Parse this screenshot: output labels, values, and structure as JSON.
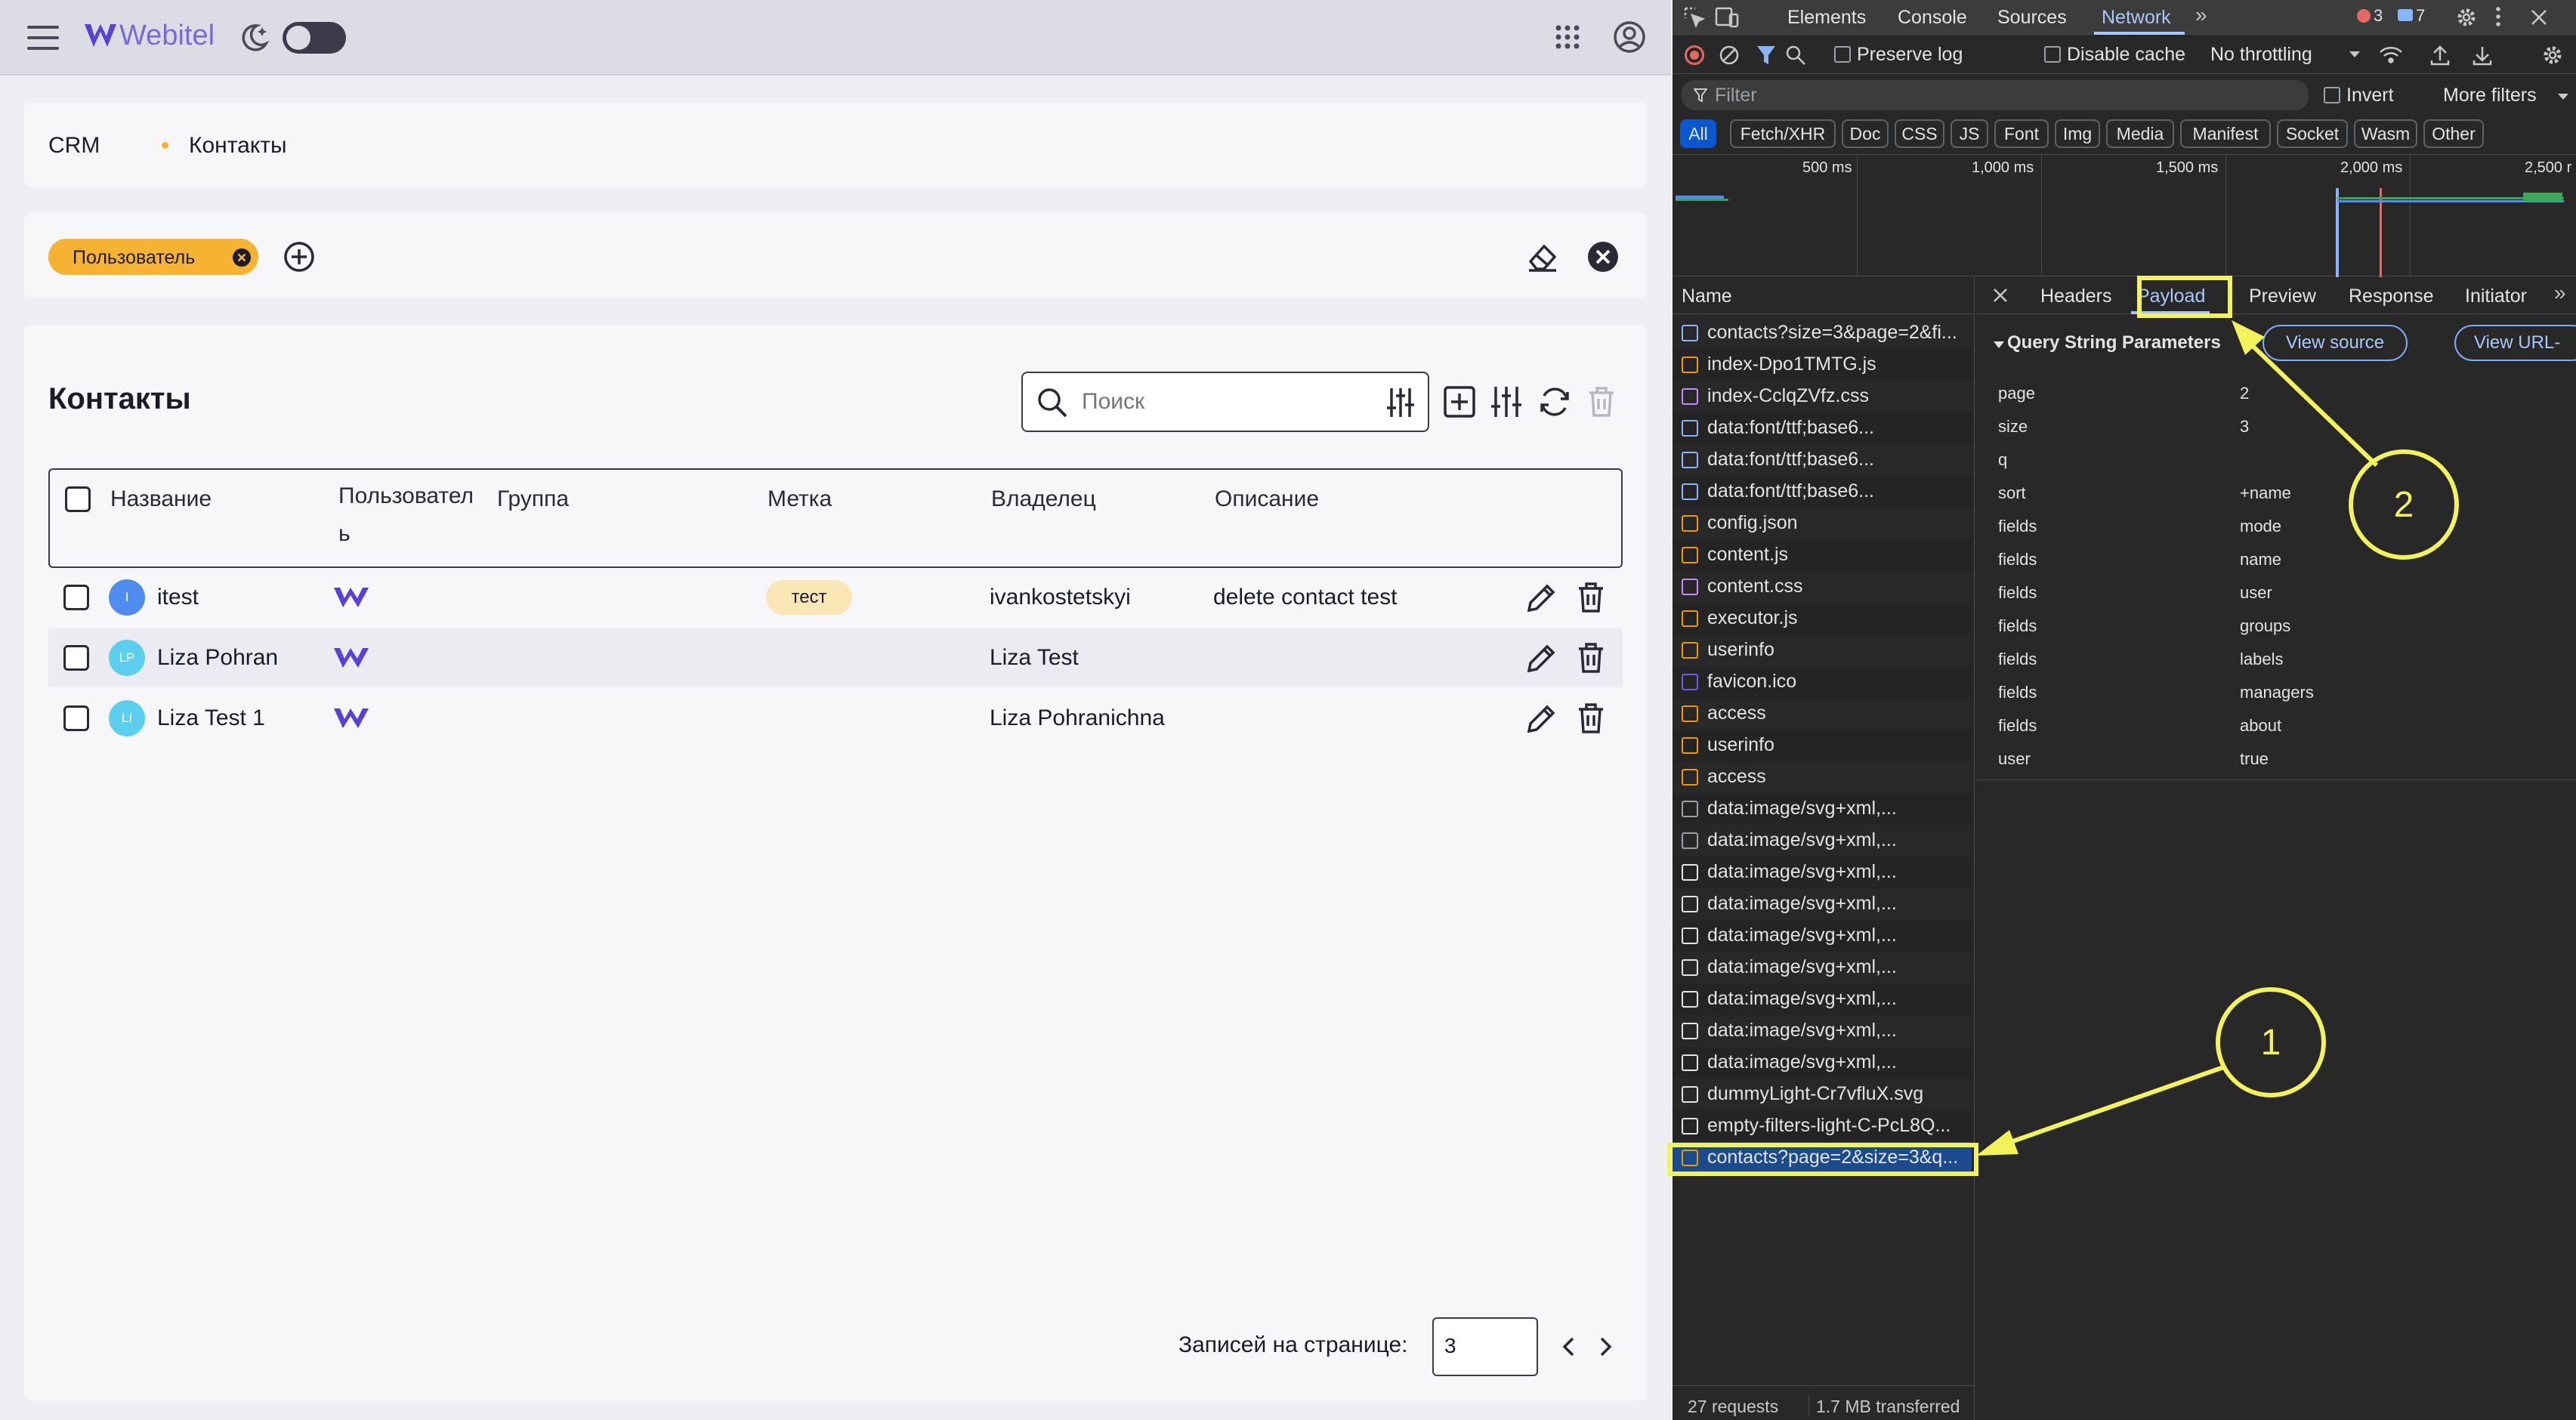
{
  "app": {
    "logo_text": "Webitel",
    "breadcrumb": {
      "root": "CRM",
      "current": "Контакты"
    },
    "filter_chip": "Пользователь",
    "page_title": "Контакты",
    "search_placeholder": "Поиск",
    "columns": [
      "Название",
      "Пользовател ь",
      "Группа",
      "Метка",
      "Владелец",
      "Описание"
    ],
    "rows": [
      {
        "initials": "I",
        "name": "itest",
        "label": "тест",
        "owner": "ivankostetskyi",
        "description": "delete contact test",
        "avatar_color": "#4f8ef0"
      },
      {
        "initials": "LP",
        "name": "Liza Pohran",
        "label": "",
        "owner": "Liza Test",
        "description": "",
        "avatar_color": "#5ccfee"
      },
      {
        "initials": "LI",
        "name": "Liza Test 1",
        "label": "",
        "owner": "Liza Pohranichna",
        "description": "",
        "avatar_color": "#5ccfee"
      }
    ],
    "per_page_label": "Записей на странице:",
    "per_page_value": "3",
    "colors": {
      "accent": "#f6b332",
      "brand": "#5a3fd8",
      "chip_label_bg": "#fbe7b5"
    }
  },
  "devtools": {
    "tabs": [
      "Elements",
      "Console",
      "Sources",
      "Network"
    ],
    "active_tab": "Network",
    "error_count": "3",
    "message_count": "7",
    "preserve_log": "Preserve log",
    "disable_cache": "Disable cache",
    "throttling": "No throttling",
    "filter_placeholder": "Filter",
    "invert": "Invert",
    "more_filters": "More filters",
    "type_filters": [
      "All",
      "Fetch/XHR",
      "Doc",
      "CSS",
      "JS",
      "Font",
      "Img",
      "Media",
      "Manifest",
      "Socket",
      "Wasm",
      "Other"
    ],
    "timeline_ticks": [
      "500 ms",
      "1,000 ms",
      "1,500 ms",
      "2,000 ms",
      "2,500 r"
    ],
    "name_header": "Name",
    "requests": [
      {
        "name": "contacts?size=3&page=2&fi...",
        "icon": "doc",
        "color": "#8ab4f8"
      },
      {
        "name": "index-Dpo1TMTG.js",
        "icon": "script",
        "color": "#f29900"
      },
      {
        "name": "index-CclqZVfz.css",
        "icon": "css",
        "color": "#c58af9"
      },
      {
        "name": "data:font/ttf;base6...",
        "icon": "font",
        "color": "#8ab4f8"
      },
      {
        "name": "data:font/ttf;base6...",
        "icon": "font",
        "color": "#8ab4f8"
      },
      {
        "name": "data:font/ttf;base6...",
        "icon": "font",
        "color": "#8ab4f8"
      },
      {
        "name": "config.json",
        "icon": "fetch",
        "color": "#f29900"
      },
      {
        "name": "content.js",
        "icon": "script",
        "color": "#f29900"
      },
      {
        "name": "content.css",
        "icon": "css",
        "color": "#c58af9"
      },
      {
        "name": "executor.js",
        "icon": "script",
        "color": "#f29900"
      },
      {
        "name": "userinfo",
        "icon": "fetch",
        "color": "#f29900"
      },
      {
        "name": "favicon.ico",
        "icon": "favicon",
        "color": "#6c5ce7"
      },
      {
        "name": "access",
        "icon": "fetch",
        "color": "#f29900"
      },
      {
        "name": "userinfo",
        "icon": "fetch",
        "color": "#f29900"
      },
      {
        "name": "access",
        "icon": "fetch",
        "color": "#f29900"
      },
      {
        "name": "data:image/svg+xml,...",
        "icon": "image",
        "color": "#9aa0a6"
      },
      {
        "name": "data:image/svg+xml,...",
        "icon": "image",
        "color": "#9aa0a6"
      },
      {
        "name": "data:image/svg+xml,...",
        "icon": "image",
        "color": "#e3e3e3"
      },
      {
        "name": "data:image/svg+xml,...",
        "icon": "image",
        "color": "#e3e3e3"
      },
      {
        "name": "data:image/svg+xml,...",
        "icon": "image",
        "color": "#e3e3e3"
      },
      {
        "name": "data:image/svg+xml,...",
        "icon": "image",
        "color": "#e3e3e3"
      },
      {
        "name": "data:image/svg+xml,...",
        "icon": "image",
        "color": "#e3e3e3"
      },
      {
        "name": "data:image/svg+xml,...",
        "icon": "image",
        "color": "#e3e3e3"
      },
      {
        "name": "data:image/svg+xml,...",
        "icon": "image",
        "color": "#e3e3e3"
      },
      {
        "name": "dummyLight-Cr7vfluX.svg",
        "icon": "image",
        "color": "#e3e3e3"
      },
      {
        "name": "empty-filters-light-C-PcL8Q...",
        "icon": "image",
        "color": "#e3e3e3"
      },
      {
        "name": "contacts?page=2&size=3&q...",
        "icon": "fetch",
        "color": "#f29900"
      }
    ],
    "detail_tabs": [
      "Headers",
      "Payload",
      "Preview",
      "Response",
      "Initiator"
    ],
    "active_detail_tab": "Payload",
    "section_title": "Query String Parameters",
    "view_source": "View source",
    "view_url": "View URL-",
    "params": [
      {
        "key": "page",
        "value": "2"
      },
      {
        "key": "size",
        "value": "3"
      },
      {
        "key": "q",
        "value": ""
      },
      {
        "key": "sort",
        "value": "+name"
      },
      {
        "key": "fields",
        "value": "mode"
      },
      {
        "key": "fields",
        "value": "name"
      },
      {
        "key": "fields",
        "value": "user"
      },
      {
        "key": "fields",
        "value": "groups"
      },
      {
        "key": "fields",
        "value": "labels"
      },
      {
        "key": "fields",
        "value": "managers"
      },
      {
        "key": "fields",
        "value": "about"
      },
      {
        "key": "user",
        "value": "true"
      }
    ],
    "status_requests": "27 requests",
    "status_transferred": "1.7 MB transferred"
  },
  "annotations": {
    "marker_1": "1",
    "marker_2": "2",
    "highlight_color": "#f2f25a"
  }
}
